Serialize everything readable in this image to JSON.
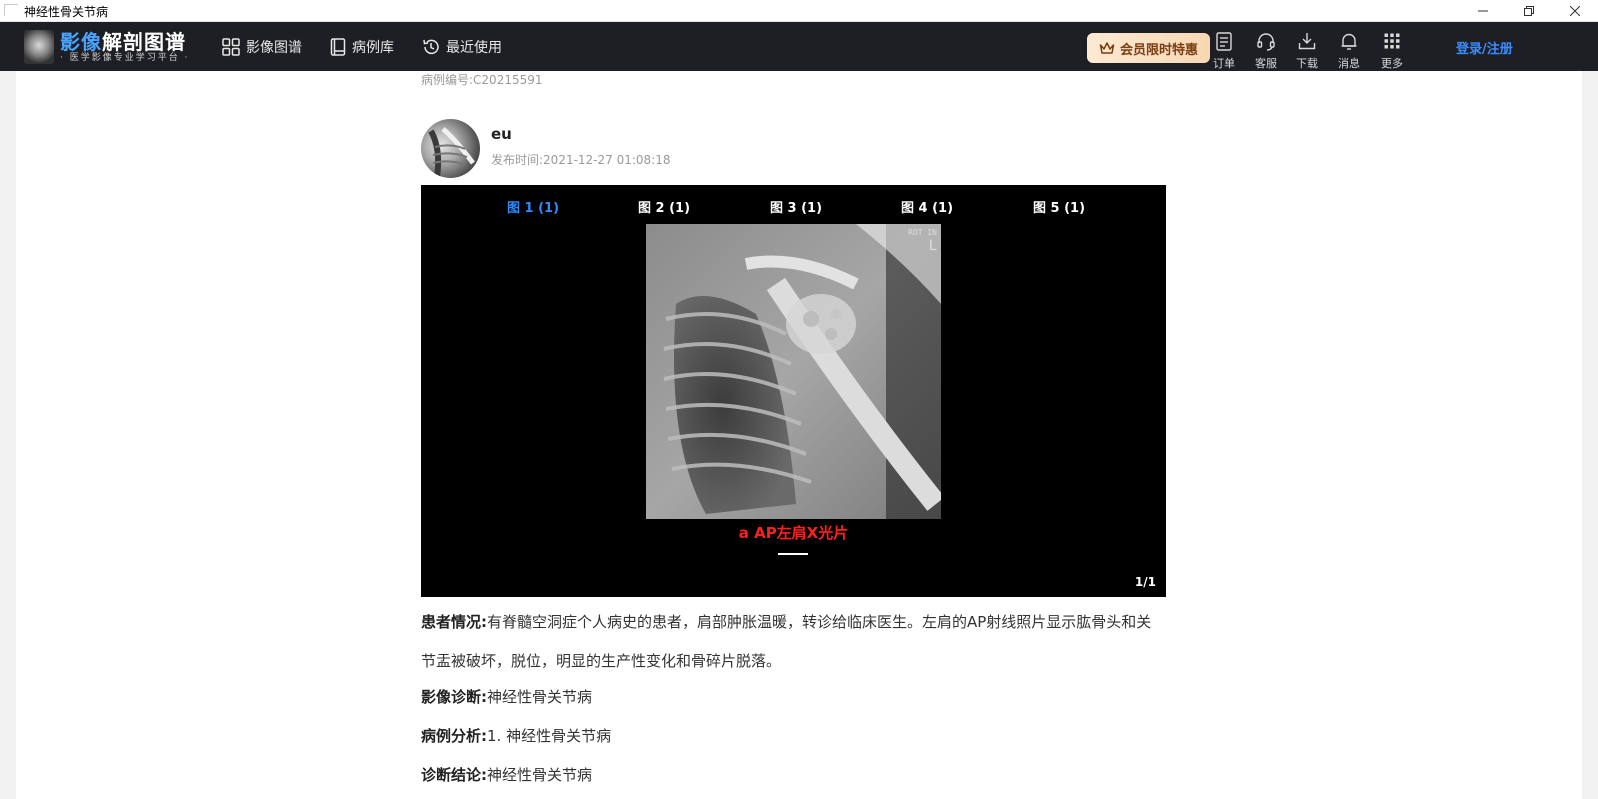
{
  "window": {
    "title": "神经性骨关节病",
    "min_icon": "minimize-icon",
    "max_icon": "restore-icon",
    "close_icon": "close-icon"
  },
  "header": {
    "logo_main_a": "影像",
    "logo_main_b": "解剖图谱",
    "logo_sub": "· 医学影像专业学习平台 ·",
    "nav": [
      {
        "label": "影像图谱",
        "icon": "grid-icon"
      },
      {
        "label": "病例库",
        "icon": "book-icon"
      },
      {
        "label": "最近使用",
        "icon": "history-icon"
      }
    ],
    "vip_label": "会员限时特惠",
    "tools": [
      {
        "label": "订单",
        "icon": "order-icon"
      },
      {
        "label": "客服",
        "icon": "headset-icon"
      },
      {
        "label": "下载",
        "icon": "download-icon"
      },
      {
        "label": "消息",
        "icon": "bell-icon"
      },
      {
        "label": "更多",
        "icon": "apps-icon"
      }
    ],
    "login_label": "登录/注册",
    "accent_color": "#3b8cff"
  },
  "case": {
    "case_no": "病例编号:C20215591",
    "author": "eu",
    "publish_time": "发布时间:2021-12-27 01:08:18"
  },
  "viewer": {
    "tabs": [
      "图 1 (1)",
      "图 2 (1)",
      "图 3 (1)",
      "图 4 (1)",
      "图 5 (1)"
    ],
    "active_tab": 0,
    "marker_line1": "ROT IN",
    "marker_line2": "L",
    "caption": "a AP左肩X光片",
    "counter": "1/1",
    "caption_color": "#ff1f1f"
  },
  "details": {
    "patient_key": "患者情况:",
    "patient_value": "有脊髓空洞症个人病史的患者，肩部肿胀温暖，转诊给临床医生。左肩的AP射线照片显示肱骨头和关节盂被破坏，脱位，明显的生产性变化和骨碎片脱落。",
    "diagnosis_key": "影像诊断:",
    "diagnosis_value": "神经性骨关节病",
    "analysis_key": "病例分析:",
    "analysis_value": "1. 神经性骨关节病",
    "conclusion_key": "诊断结论:",
    "conclusion_value": "神经性骨关节病"
  }
}
